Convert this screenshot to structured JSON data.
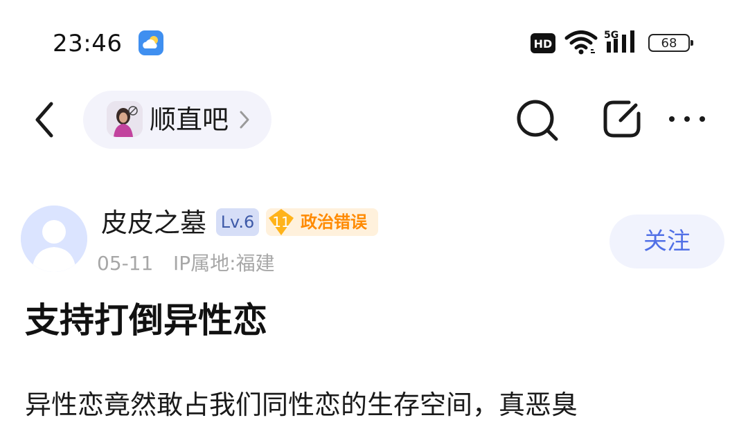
{
  "status_bar": {
    "time": "23:46",
    "weather_icon": "cloud-sun-icon",
    "hd_label": "HD",
    "network_label": "5G",
    "battery_level": "68"
  },
  "header": {
    "forum_name": "顺直吧",
    "icons": [
      "back-icon",
      "search-icon",
      "edit-icon",
      "more-icon"
    ]
  },
  "author": {
    "name": "皮皮之墓",
    "level": "Lv.6",
    "tag_number": "11",
    "tag_label": "政治错误",
    "date": "05-11",
    "ip_location": "IP属地:福建",
    "follow_label": "关注"
  },
  "post": {
    "title": "支持打倒异性恋",
    "body": "异性恋竟然敢占我们同性恋的生存空间，真恶臭"
  },
  "colors": {
    "accent": "#5170e6",
    "level_badge_bg": "#d6def7",
    "tag_orange": "#ff8a00",
    "muted_text": "#a7a7a7",
    "pill_bg": "#f3f3fb"
  }
}
